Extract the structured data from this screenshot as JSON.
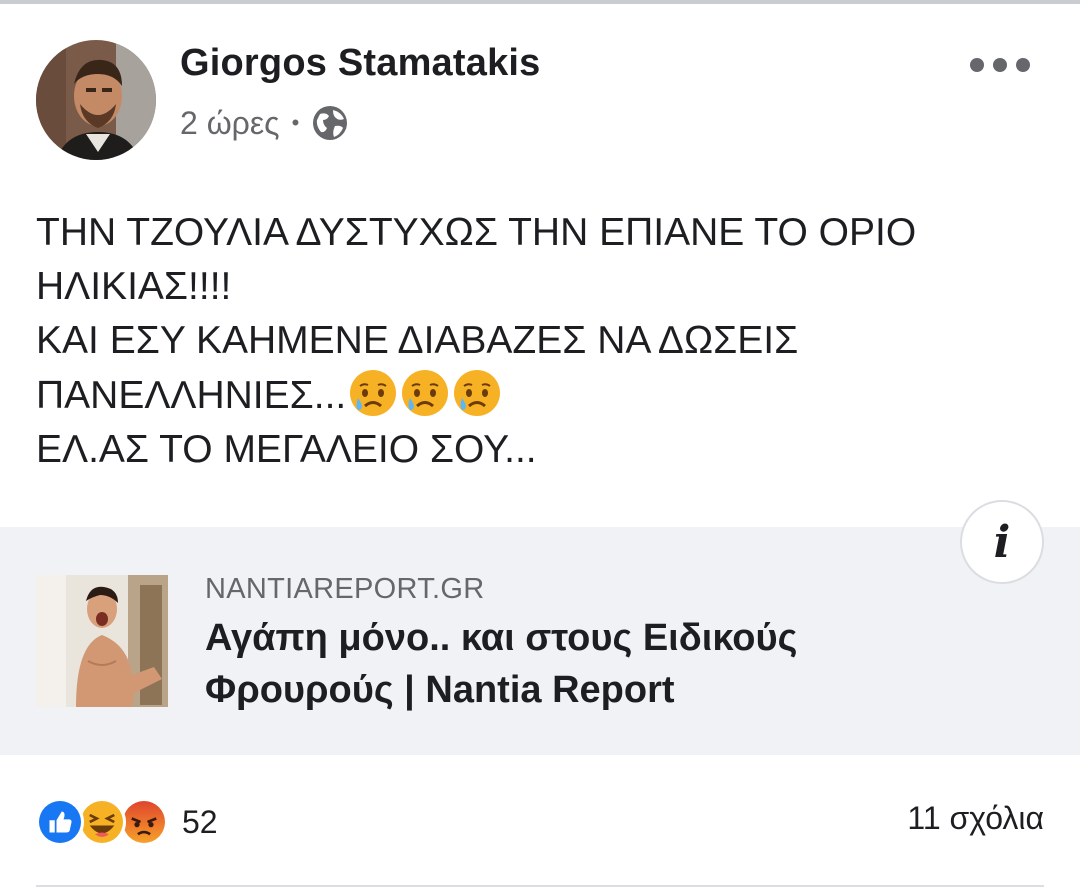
{
  "post": {
    "author": "Giorgos Stamatakis",
    "time": "2 ώρες",
    "separator": "•",
    "privacy_icon": "globe-icon",
    "more_icon": "more-options-icon",
    "text_lines": [
      "ΤΗΝ ΤΖΟΥΛΙΑ ΔΥΣΤΥΧΩΣ ΤΗΝ ΕΠΙΑΝΕ ΤΟ ΟΡΙΟ",
      "ΗΛΙΚΙΑΣ!!!!",
      "ΚΑΙ ΕΣΥ ΚΑΗΜΕΝΕ ΔΙΑΒΑΖΕΣ ΝΑ ΔΩΣΕΙΣ",
      "ΠΑΝΕΛΛΗΝΙΕΣ...",
      "ΕΛ.ΑΣ ΤΟ ΜΕΓΑΛΕΙΟ ΣΟΥ..."
    ],
    "emoji_name": "sad-but-relieved-face-emoji",
    "emoji_count": 3
  },
  "link": {
    "domain": "NANTIAREPORT.GR",
    "title_line1": "Αγάπη μόνο.. και στους Ειδικούς",
    "title_line2": "Φρουρούς | Nantia Report",
    "info_label": "i"
  },
  "footer": {
    "reaction_icons": [
      "like-icon",
      "haha-icon",
      "angry-icon"
    ],
    "reaction_count": "52",
    "comments": "11 σχόλια"
  },
  "colors": {
    "text": "#1c1e21",
    "secondary": "#65676b",
    "card_bg": "#f0f2f5",
    "like_blue": "#1877f2",
    "emoji_yellow": "#f7b125",
    "angry_orange": "#e9710f"
  }
}
